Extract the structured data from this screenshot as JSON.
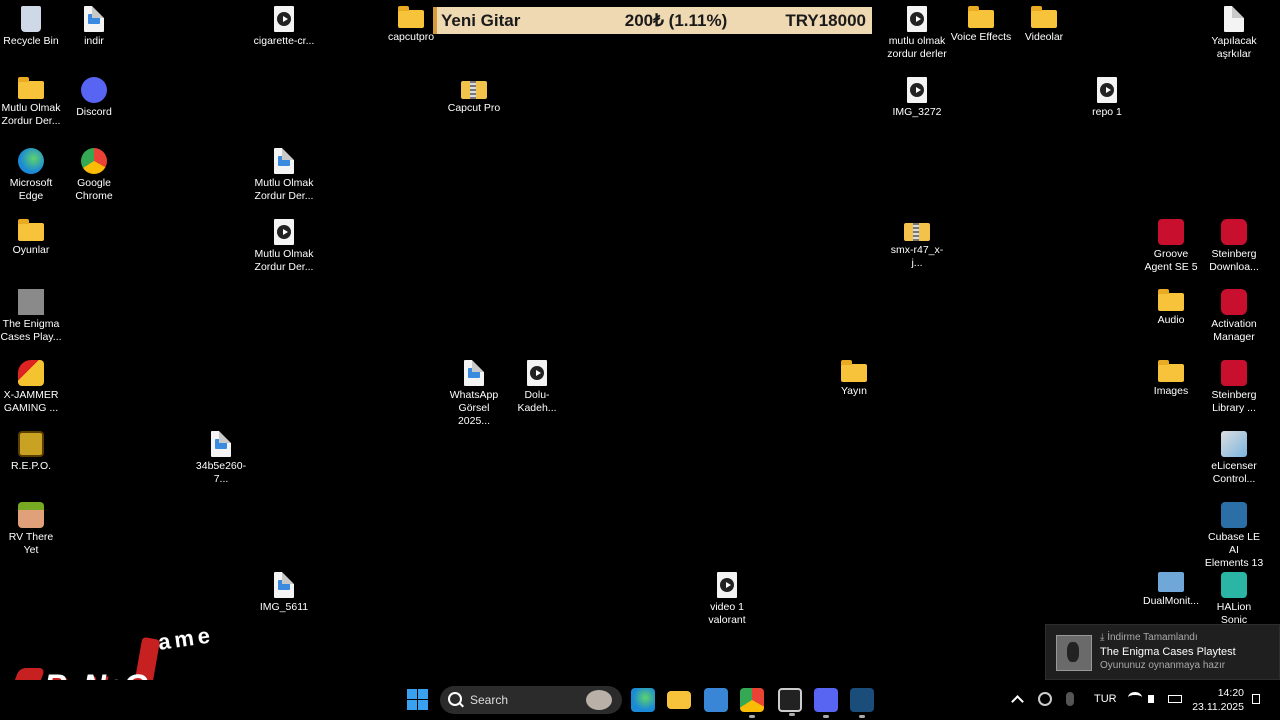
{
  "desktop": {
    "icons": {
      "recycle_bin": "Recycle Bin",
      "indir": "indir",
      "cigarette": "cigarette-cr...",
      "capcutpro": "capcutpro",
      "mutlu_olmak_zordur_derler": "mutlu olmak\nzordur derler",
      "voice_effects": "Voice Effects",
      "videolar": "Videolar",
      "yapilacak": "Yapılacak\naşrkılar",
      "mutlu_folder": "Mutlu Olmak\nZordur Der...",
      "discord": "Discord",
      "capcut_pro": "Capcut Pro",
      "img_3272": "IMG_3272",
      "repo_1": "repo 1",
      "edge": "Microsoft\nEdge",
      "chrome": "Google\nChrome",
      "mutlu_img": "Mutlu Olmak\nZordur Der...",
      "oyunlar": "Oyunlar",
      "mutlu_vid": "Mutlu Olmak\nZordur Der...",
      "smx": "smx-r47_x-j...",
      "groove": "Groove\nAgent SE 5",
      "steinberg_download": "Steinberg\nDownloa...",
      "enigma": "The Enigma\nCases Play...",
      "audio": "Audio",
      "activation": "Activation\nManager",
      "xjammer": "X-JAMMER\nGAMING ...",
      "whatsapp": "WhatsApp\nGörsel 2025...",
      "dolu": "Dolu-Kadeh...",
      "yayin": "Yayın",
      "images": "Images",
      "steinberg_library": "Steinberg\nLibrary ...",
      "repo_game": "R.E.P.O.",
      "img_34b5": "34b5e260-7...",
      "elicenser": "eLicenser\nControl...",
      "rv": "RV There Yet",
      "cubase": "Cubase LE AI\nElements 13",
      "img_5611": "IMG_5611",
      "video1": "video 1\nvalorant",
      "dualmonitor": "DualMonit...",
      "halion": "HALion Sonic"
    }
  },
  "ticker": {
    "name": "Yeni Gitar",
    "change": "200₺ (1.11%)",
    "price": "TRY18000"
  },
  "watermark": {
    "text": "ByNoG",
    "text2": "ame"
  },
  "notification": {
    "header": "İndirme Tamamlandı",
    "title": "The Enigma Cases Playtest",
    "subtitle": "Oyununuz oynanmaya hazır"
  },
  "taskbar": {
    "search_label": "Search",
    "language": "TUR",
    "time": "14:20",
    "date": "23.11.2025"
  },
  "colors": {
    "ticker_bg": "#efd9b3",
    "folder": "#f6c33b",
    "accent": "#3aa0f0"
  }
}
